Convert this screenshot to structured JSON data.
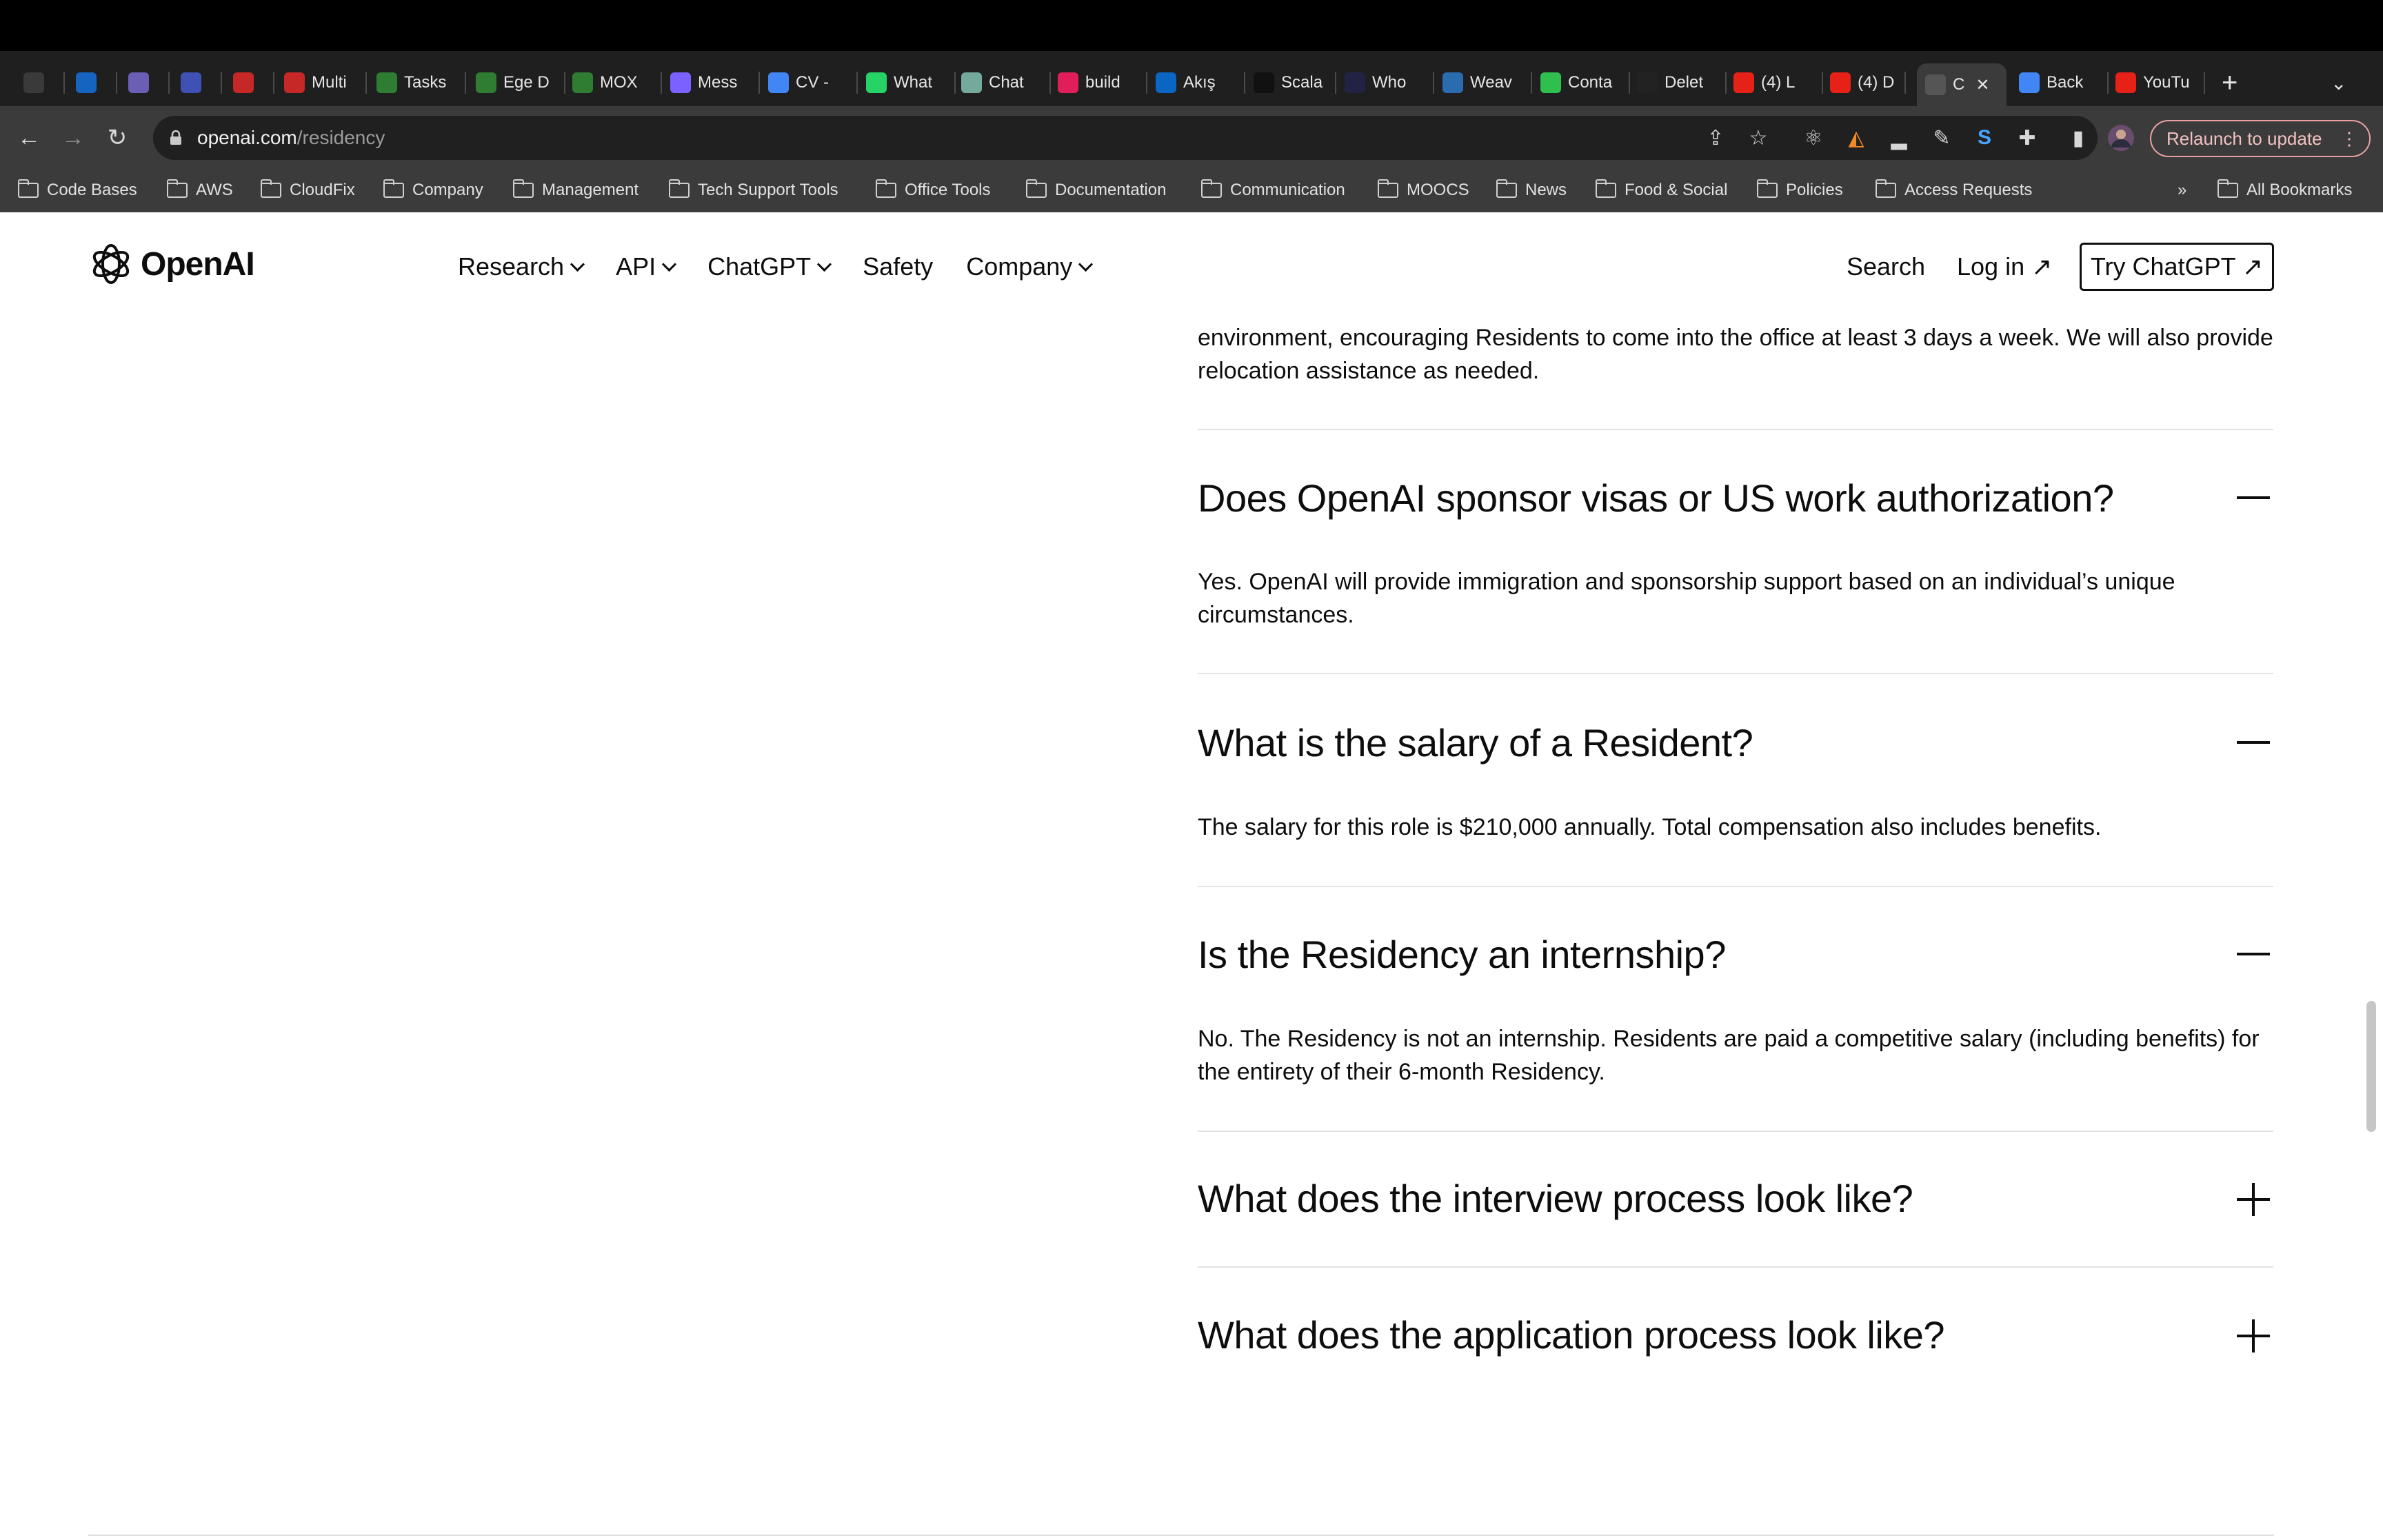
{
  "browser": {
    "tabs": [
      {
        "label": "",
        "icon": "apps-icon",
        "color": "#3a3a3a"
      },
      {
        "label": "",
        "icon": "outlook-icon",
        "color": "#1565c0"
      },
      {
        "label": "",
        "icon": "app-icon",
        "color": "#6b5fb5"
      },
      {
        "label": "",
        "icon": "timer-icon",
        "color": "#3f51b5"
      },
      {
        "label": "",
        "icon": "gmail-icon",
        "color": "#c62828"
      },
      {
        "label": "Multi",
        "icon": "gmail-icon",
        "color": "#c62828"
      },
      {
        "label": "Tasks",
        "icon": "sheets-icon",
        "color": "#2e7d32"
      },
      {
        "label": "Ege D",
        "icon": "sheets-icon",
        "color": "#2e7d32"
      },
      {
        "label": "MOX",
        "icon": "sheets-icon",
        "color": "#2e7d32"
      },
      {
        "label": "Mess",
        "icon": "messenger-icon",
        "color": "#7b61ff"
      },
      {
        "label": "CV -",
        "icon": "docs-icon",
        "color": "#4285f4"
      },
      {
        "label": "What",
        "icon": "whatsapp-icon",
        "color": "#25d366"
      },
      {
        "label": "Chat",
        "icon": "chatgpt-icon",
        "color": "#74aa9c"
      },
      {
        "label": "build",
        "icon": "slack-icon",
        "color": "#e01e5a"
      },
      {
        "label": "Akış",
        "icon": "linkedin-icon",
        "color": "#0a66c2"
      },
      {
        "label": "Scala",
        "icon": "medium-icon",
        "color": "#111111"
      },
      {
        "label": "Who",
        "icon": "v-icon",
        "color": "#222244"
      },
      {
        "label": "Weav",
        "icon": "weave-icon",
        "color": "#2b6cb0"
      },
      {
        "label": "Conta",
        "icon": "dot-icon",
        "color": "#2fbf4f"
      },
      {
        "label": "Delet",
        "icon": "github-icon",
        "color": "#222222"
      },
      {
        "label": "(4) L",
        "icon": "youtube-icon",
        "color": "#e62117"
      },
      {
        "label": "(4) D",
        "icon": "youtube-icon",
        "color": "#e62117"
      },
      {
        "label": "C",
        "icon": "openai-icon",
        "color": "#555555",
        "active": true
      },
      {
        "label": "Back",
        "icon": "docs-icon",
        "color": "#4285f4"
      },
      {
        "label": "YouTu",
        "icon": "youtube-icon",
        "color": "#e62117"
      }
    ],
    "url_host": "openai.com",
    "url_path": "/residency",
    "relaunch_label": "Relaunch to update",
    "bookmarks": [
      "Code Bases",
      "AWS",
      "CloudFix",
      "Company",
      "Management",
      "Tech Support Tools",
      "Office Tools",
      "Documentation",
      "Communication",
      "MOOCS",
      "News",
      "Food & Social",
      "Policies",
      "Access Requests"
    ],
    "bookmarks_overflow": "»",
    "all_bookmarks": "All Bookmarks"
  },
  "site": {
    "logo_text": "OpenAI",
    "nav": [
      {
        "label": "Research",
        "dropdown": true
      },
      {
        "label": "API",
        "dropdown": true
      },
      {
        "label": "ChatGPT",
        "dropdown": true
      },
      {
        "label": "Safety",
        "dropdown": false
      },
      {
        "label": "Company",
        "dropdown": true
      }
    ],
    "search_label": "Search",
    "login_label": "Log in ↗",
    "try_label": "Try ChatGPT ↗"
  },
  "faq": {
    "partial_answer": "environment, encouraging Residents to come into the office at least 3 days a week. We will also provide relocation assistance as needed.",
    "items": [
      {
        "question": "Does OpenAI sponsor visas or US work authorization?",
        "answer": "Yes. OpenAI will provide immigration and sponsorship support based on an individual’s unique circumstances.",
        "expanded": true
      },
      {
        "question": "What is the salary of a Resident?",
        "answer": "The salary for this role is $210,000 annually. Total compensation also includes benefits.",
        "expanded": true
      },
      {
        "question": "Is the Residency an internship?",
        "answer": "No. The Residency is not an internship. Residents are paid a competitive salary (including benefits) for the entirety of their 6-month Residency.",
        "expanded": true
      },
      {
        "question": "What does the interview process look like?",
        "answer": "",
        "expanded": false
      },
      {
        "question": "What does the application process look like?",
        "answer": "",
        "expanded": false
      }
    ]
  }
}
